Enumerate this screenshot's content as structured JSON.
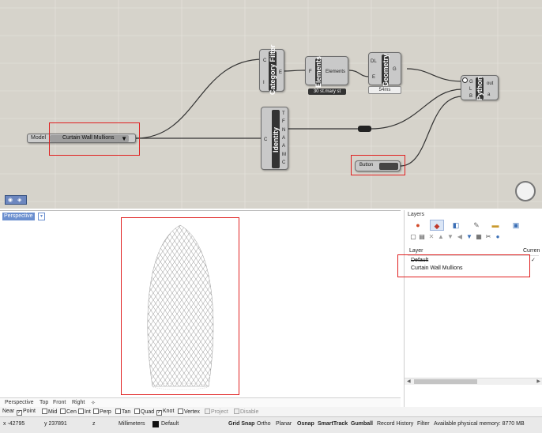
{
  "grasshopper": {
    "value_list": {
      "left_label": "Model",
      "value": "Curtain Wall Mullions"
    },
    "category_filter": {
      "label": "Category Filter",
      "inputs": [
        "C",
        "I"
      ],
      "outputs": [
        "E"
      ]
    },
    "elements": {
      "label": "Elements",
      "input": "F",
      "output": "Elements",
      "caption": "30 st.mary st"
    },
    "geometry": {
      "label": "Geometry",
      "inputs": [
        "DL",
        "E"
      ],
      "outputs": [
        "G"
      ],
      "caption": "54ms"
    },
    "identity": {
      "label": "Identity",
      "input": "C",
      "outputs": [
        "T",
        "F",
        "N",
        "A",
        "A",
        "M",
        "C"
      ]
    },
    "python": {
      "label": "Python",
      "inputs": [
        "G",
        "L",
        "B"
      ],
      "outputs": [
        "out",
        "a"
      ]
    },
    "button": {
      "label": "Button"
    },
    "colors": {
      "canvas": "#d6d3cb",
      "highlight": "#e02020"
    }
  },
  "viewport": {
    "name": "Perspective",
    "dropdown_icon": "chevron-down-icon"
  },
  "layers_panel": {
    "title": "Layers",
    "tab_icons": [
      "layers-tab-icon",
      "properties-tab-icon",
      "display-tab-icon",
      "render-tab-icon",
      "folder-tab-icon",
      "help-tab-icon"
    ],
    "tool_icons": [
      "new-layer-icon",
      "new-sublayer-icon",
      "delete-icon",
      "move-up-icon",
      "move-down-icon",
      "back-icon",
      "filter-icon",
      "tools-icon",
      "help-icon"
    ],
    "col_layer": "Layer",
    "col_current": "Curren",
    "rows": [
      "Default",
      "Curtain Wall Mullions"
    ]
  },
  "viewport_tabs": [
    "Perspective",
    "Top",
    "Front",
    "Right"
  ],
  "osnap": [
    {
      "label": "Near",
      "checked": false,
      "plain": true
    },
    {
      "label": "Point",
      "checked": true
    },
    {
      "label": "Mid",
      "checked": false
    },
    {
      "label": "Cen",
      "checked": false
    },
    {
      "label": "Int",
      "checked": false
    },
    {
      "label": "Perp",
      "checked": false
    },
    {
      "label": "Tan",
      "checked": false
    },
    {
      "label": "Quad",
      "checked": false
    },
    {
      "label": "Knot",
      "checked": true
    },
    {
      "label": "Vertex",
      "checked": false
    },
    {
      "label": "Project",
      "checked": false,
      "dim": true
    },
    {
      "label": "Disable",
      "checked": false,
      "dim": true
    }
  ],
  "status": {
    "x": "x -42795",
    "y": "y 237891",
    "z": "z",
    "units": "Millimeters",
    "layer": "Default",
    "toggles": [
      "Grid Snap",
      "Ortho",
      "Planar",
      "Osnap",
      "SmartTrack",
      "Gumball",
      "Record History",
      "Filter"
    ],
    "bold_toggles": [
      "Grid Snap",
      "Osnap",
      "SmartTrack",
      "Gumball"
    ],
    "memory": "Available physical memory: 8770 MB"
  }
}
